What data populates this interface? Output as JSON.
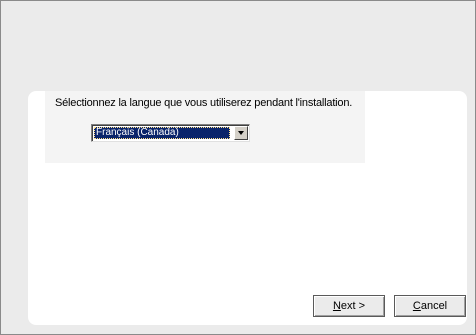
{
  "dialog": {
    "instruction": "Sélectionnez la langue que vous utiliserez pendant l'installation.",
    "language_select": {
      "selected": "Français (Canada)",
      "icon": "chevron-down-icon"
    }
  },
  "buttons": {
    "next": {
      "access_key": "N",
      "label_rest": "ext >"
    },
    "cancel": {
      "access_key": "C",
      "label_rest": "ancel"
    }
  },
  "colors": {
    "selection_highlight": "#0a246a",
    "window_background": "#ebebeb",
    "panel_background": "#ffffff"
  }
}
